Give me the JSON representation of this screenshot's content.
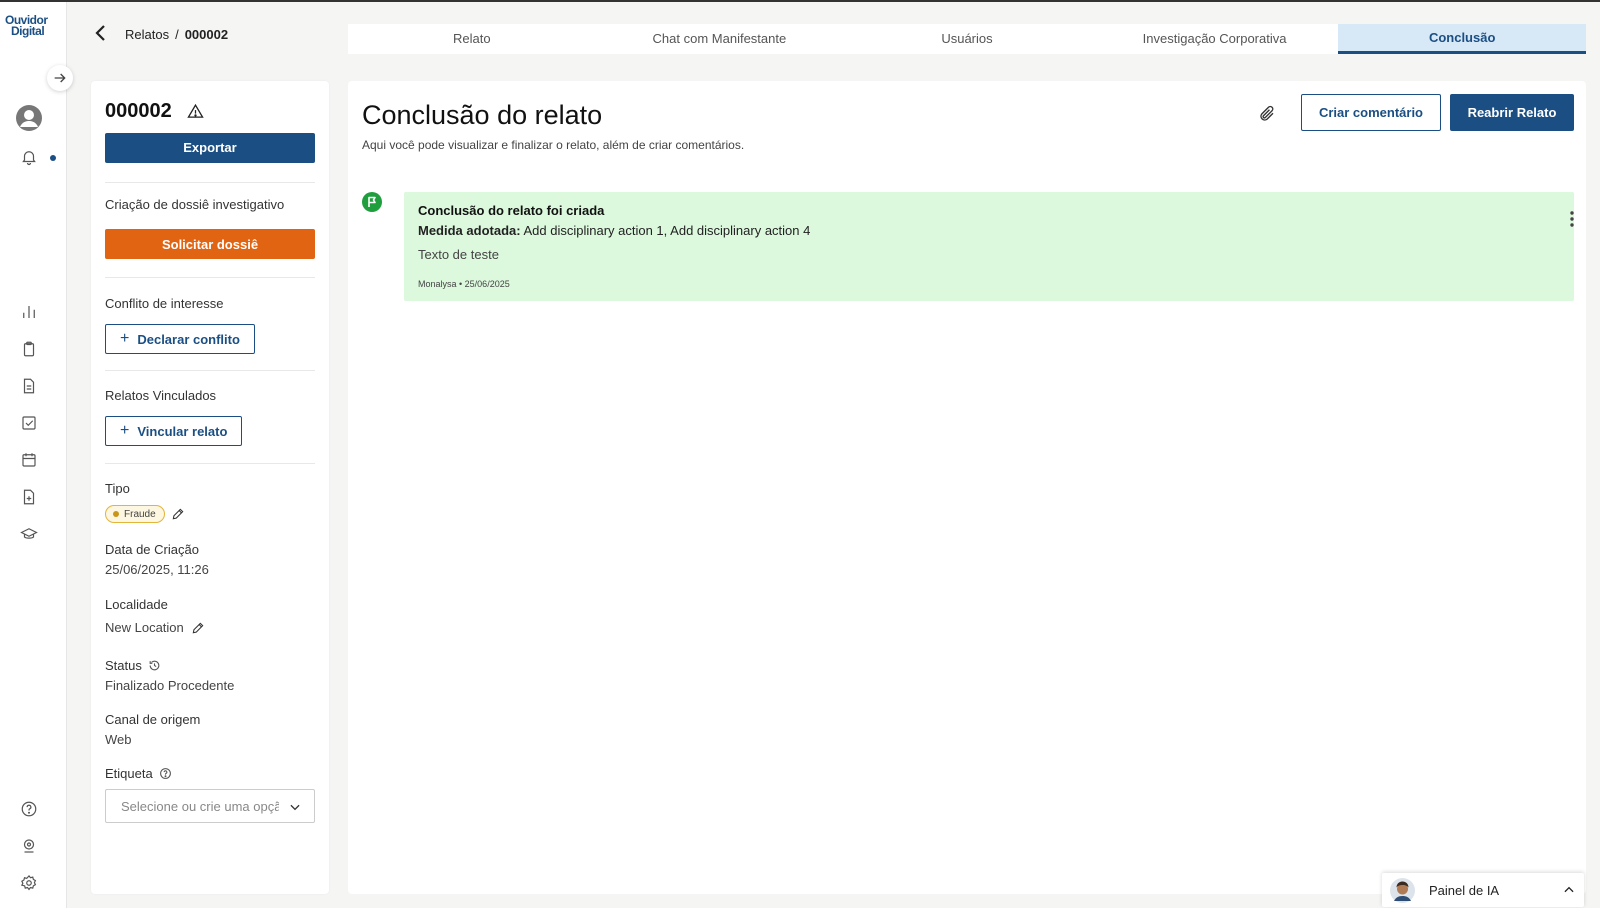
{
  "brand": {
    "logo_line1": "Ouvidor",
    "logo_line2": "Digital"
  },
  "breadcrumb": {
    "parent": "Relatos",
    "separator": "/",
    "current": "000002"
  },
  "tabs": [
    {
      "label": "Relato",
      "active": false
    },
    {
      "label": "Chat com Manifestante",
      "active": false
    },
    {
      "label": "Usuários",
      "active": false
    },
    {
      "label": "Investigação Corporativa",
      "active": false
    },
    {
      "label": "Conclusão",
      "active": true
    }
  ],
  "side": {
    "report_id": "000002",
    "export_label": "Exportar",
    "dossier_label": "Criação de dossiê investigativo",
    "dossier_button": "Solicitar dossiê",
    "conflict_label": "Conflito de interesse",
    "conflict_button": "Declarar conflito",
    "linked_label": "Relatos Vinculados",
    "linked_button": "Vincular relato",
    "type_label": "Tipo",
    "type_value": "Fraude",
    "created_label": "Data de Criação",
    "created_value": "25/06/2025, 11:26",
    "location_label": "Localidade",
    "location_value": "New Location",
    "status_label": "Status",
    "status_value": "Finalizado Procedente",
    "channel_label": "Canal de origem",
    "channel_value": "Web",
    "tag_label": "Etiqueta",
    "tag_placeholder": "Selecione ou crie uma opção"
  },
  "main": {
    "title": "Conclusão do relato",
    "subtitle": "Aqui você pode visualizar e finalizar o relato, além de criar comentários.",
    "comment_button": "Criar comentário",
    "reopen_button": "Reabrir Relato",
    "card": {
      "title": "Conclusão do relato foi criada",
      "measure_label": "Medida adotada:",
      "measure_value": " Add disciplinary action 1, Add disciplinary action 4",
      "text": "Texto de teste",
      "meta": "Monalysa • 25/06/2025"
    }
  },
  "ai_panel": {
    "label": "Painel de IA"
  },
  "colors": {
    "primary": "#1b4f83",
    "orange": "#e06411",
    "success_bg": "#dcf8dd",
    "flag_green": "#1e9e3c",
    "badge_border": "#e2b53b"
  }
}
